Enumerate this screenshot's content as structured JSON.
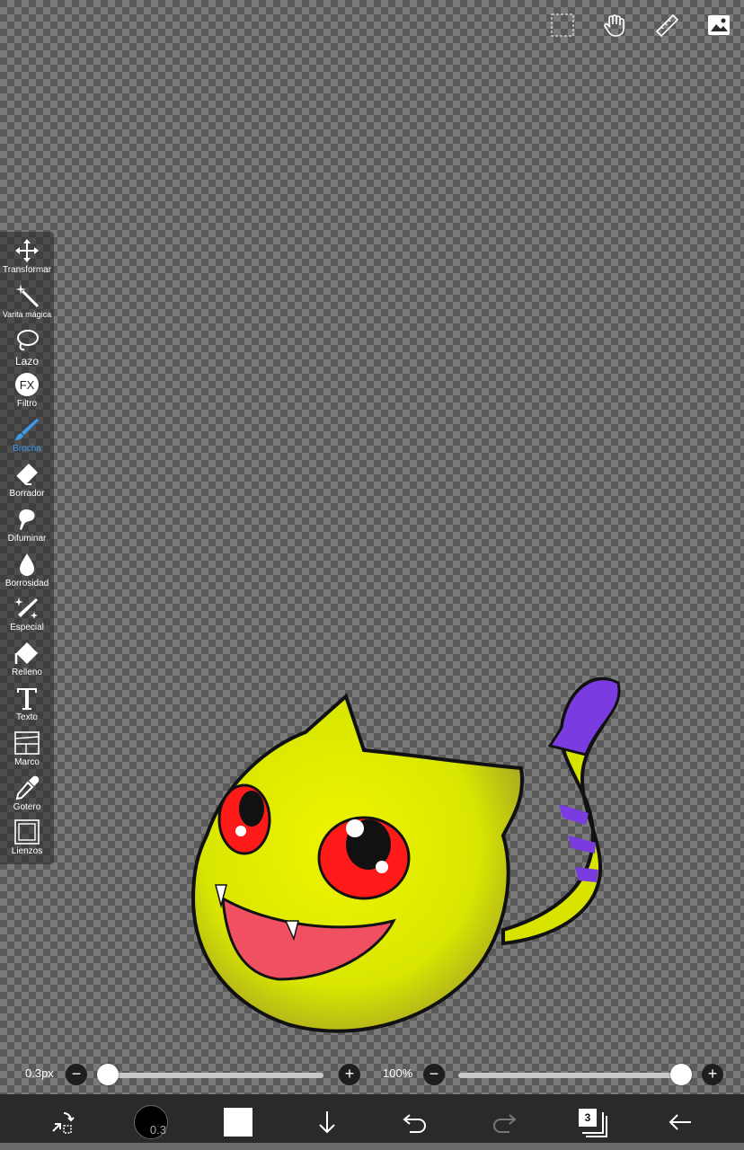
{
  "palette": {
    "tools": [
      {
        "label": "Transformar",
        "icon": "move-icon"
      },
      {
        "label": "Varita mágica",
        "icon": "magic-wand-icon"
      },
      {
        "label": "Lazo",
        "icon": "lasso-icon"
      },
      {
        "label": "Filtro",
        "icon": "fx-icon"
      },
      {
        "label": "Brocha",
        "icon": "brush-icon",
        "active": true
      },
      {
        "label": "Borrador",
        "icon": "eraser-icon"
      },
      {
        "label": "Difuminar",
        "icon": "smudge-icon"
      },
      {
        "label": "Borrosidad",
        "icon": "blur-drop-icon"
      },
      {
        "label": "Especial",
        "icon": "special-brush-icon"
      },
      {
        "label": "Relleno",
        "icon": "fill-bucket-icon"
      },
      {
        "label": "Texto",
        "icon": "text-icon"
      },
      {
        "label": "Marco",
        "icon": "frame-icon"
      },
      {
        "label": "Gotero",
        "icon": "eyedropper-icon"
      },
      {
        "label": "Lienzos",
        "icon": "canvas-icon"
      }
    ]
  },
  "sliders": {
    "size_label": "0.3px",
    "size_fraction": 0.0,
    "opacity_label": "100%",
    "opacity_fraction": 1.0
  },
  "bottom": {
    "brush_size": "0.3",
    "color": "#ffffff",
    "layer_count": "3"
  },
  "colors": {
    "accent": "#3b9cf0",
    "creature_body": "#e6f000",
    "tail_stripe": "#7a3be0",
    "eye": "#ff1a1a",
    "mouth": "#f05060"
  }
}
